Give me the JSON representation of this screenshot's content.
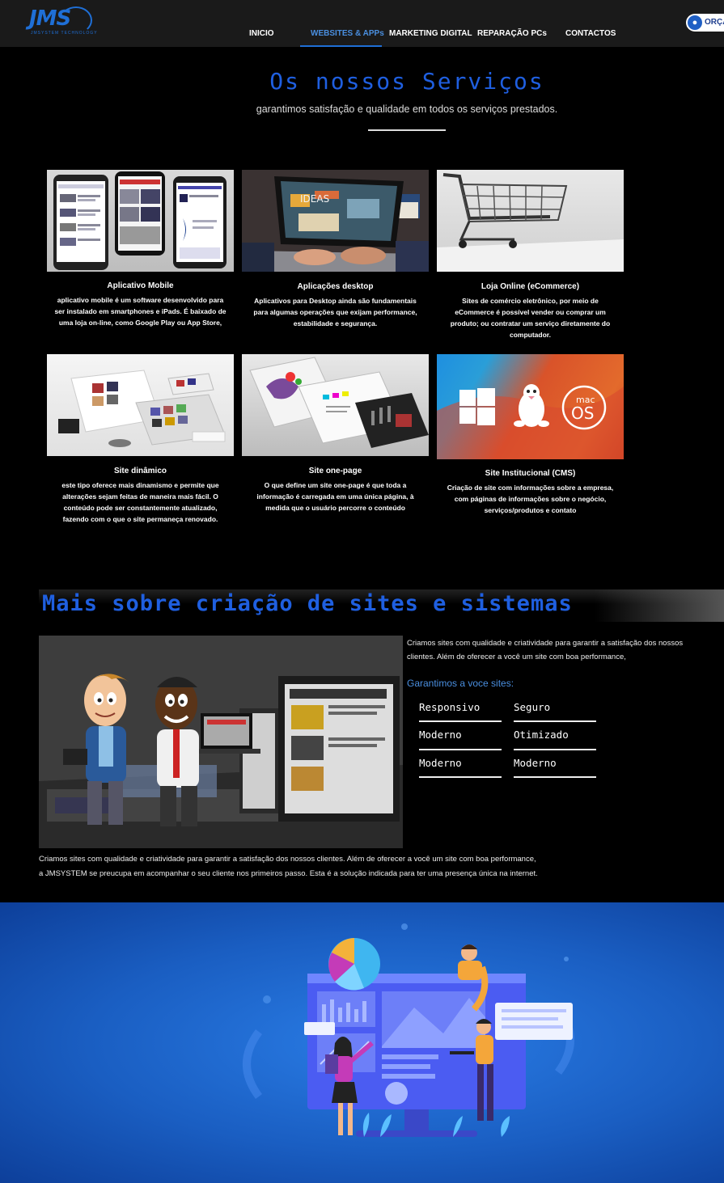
{
  "header": {
    "logo_text": "JMS",
    "logo_sub": "JMSYSTEM TECHNOLOGY",
    "nav": [
      {
        "label": "INICIO"
      },
      {
        "label": "WEBSITES & APPs"
      },
      {
        "label": "MARKETING DIGITAL"
      },
      {
        "label": "REPARAÇÃO PCs"
      },
      {
        "label": "CONTACTOS"
      }
    ],
    "cta_label": "ORÇA",
    "cta_icon": "flame-icon"
  },
  "services": {
    "title": "Os nossos Serviços",
    "subtitle": "garantimos satisfação e qualidade em todos os serviços prestados.",
    "cards": [
      {
        "title": "Aplicativo Mobile",
        "desc": "aplicativo mobile é um software desenvolvido para ser instalado em smartphones e iPads. É baixado de uma loja on-line, como Google Play ou App Store,"
      },
      {
        "title": "Aplicações desktop",
        "desc": "Aplicativos para Desktop ainda são fundamentais para algumas operações que exijam performance, estabilidade e segurança.",
        "image_text": "IDEAS"
      },
      {
        "title": "Loja Online (eCommerce)",
        "desc": "Sites de comércio eletrônico, por meio de eCommerce é possível vender ou comprar um produto; ou contratar um serviço diretamente do computador."
      },
      {
        "title": "Site dinâmico",
        "desc": "este tipo oferece mais dinamismo e permite que alterações sejam feitas de maneira mais fácil. O conteúdo pode ser constantemente atualizado, fazendo com o que o site permaneça renovado."
      },
      {
        "title": "Site one-page",
        "desc": "O que define um site one-page é que toda a informação é carregada em uma única página, à medida que o usuário percorre o conteúdo"
      },
      {
        "title": "Site Institucional (CMS)",
        "desc": "Criação de site com informações sobre a empresa, com páginas de informações sobre o negócio, serviços/produtos e contato",
        "image_text_top": "mac",
        "image_text_bottom": "OS"
      }
    ]
  },
  "mais": {
    "title": "Mais sobre criação de sites e sistemas",
    "text": "Criamos sites com qualidade e criatividade para garantir a satisfação dos nossos clientes. Além de oferecer a você um site com boa performance,",
    "garantimos": "Garantimos a voce sites:",
    "features": [
      "Responsivo",
      "Seguro",
      "Moderno",
      "Otimizado",
      "Moderno",
      "Moderno"
    ],
    "bottom_line1": "Criamos sites com qualidade e criatividade para garantir a satisfação dos nossos clientes. Além de oferecer a você um site com boa performance,",
    "bottom_line2": "a JMSYSTEM se preucupa em acompanhar o seu cliente nos primeiros passo. Esta é a solução indicada para ter uma presença única na internet."
  },
  "colors": {
    "accent": "#1f5fe0",
    "header_bg": "#1a1a1a",
    "hero_blue": "#1a5ec2"
  }
}
